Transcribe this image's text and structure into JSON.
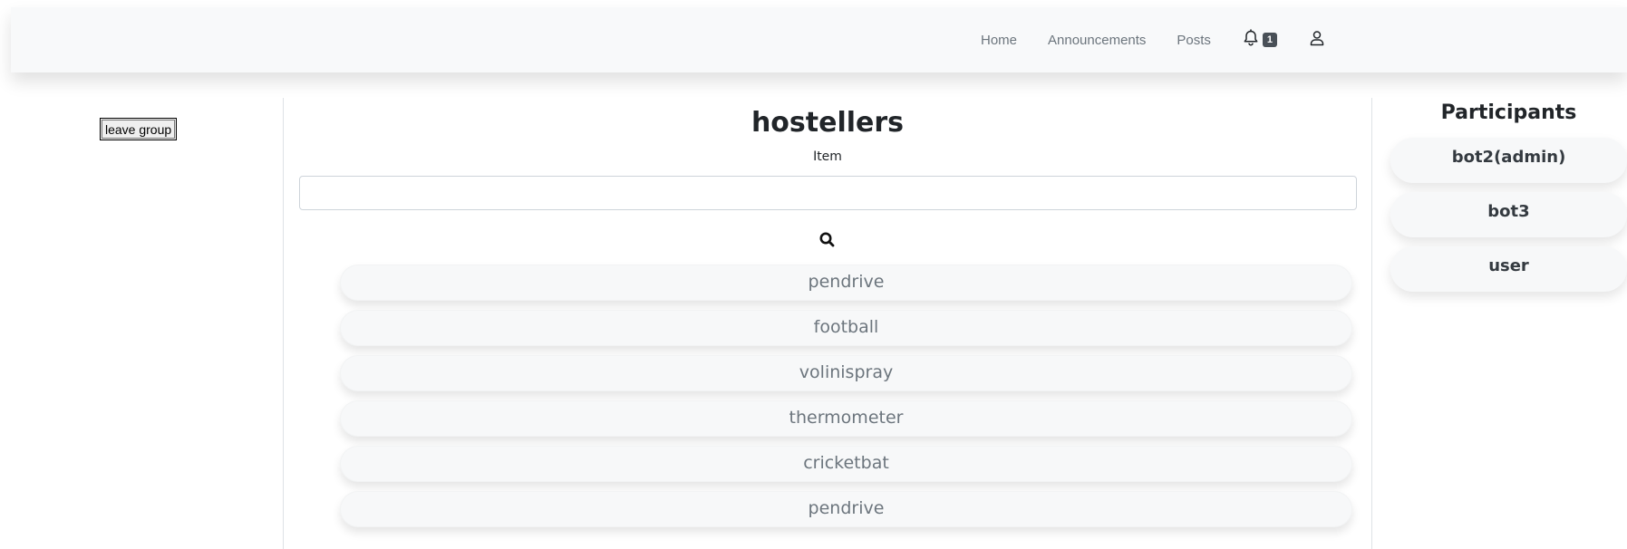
{
  "navbar": {
    "links": [
      "Home",
      "Announcements",
      "Posts"
    ],
    "notification_count": "1",
    "icons": {
      "notifications": "bell-icon",
      "profile": "user-icon"
    }
  },
  "sidebar": {
    "leave_button_label": "leave group"
  },
  "main": {
    "group_title": "hostellers",
    "item_label": "Item",
    "item_input_value": "",
    "search_icon": "search-icon",
    "items": [
      "pendrive",
      "football",
      "volinispray",
      "thermometer",
      "cricketbat",
      "pendrive"
    ]
  },
  "participants": {
    "title": "Participants",
    "members": [
      "bot2(admin)",
      "bot3",
      "user"
    ]
  }
}
